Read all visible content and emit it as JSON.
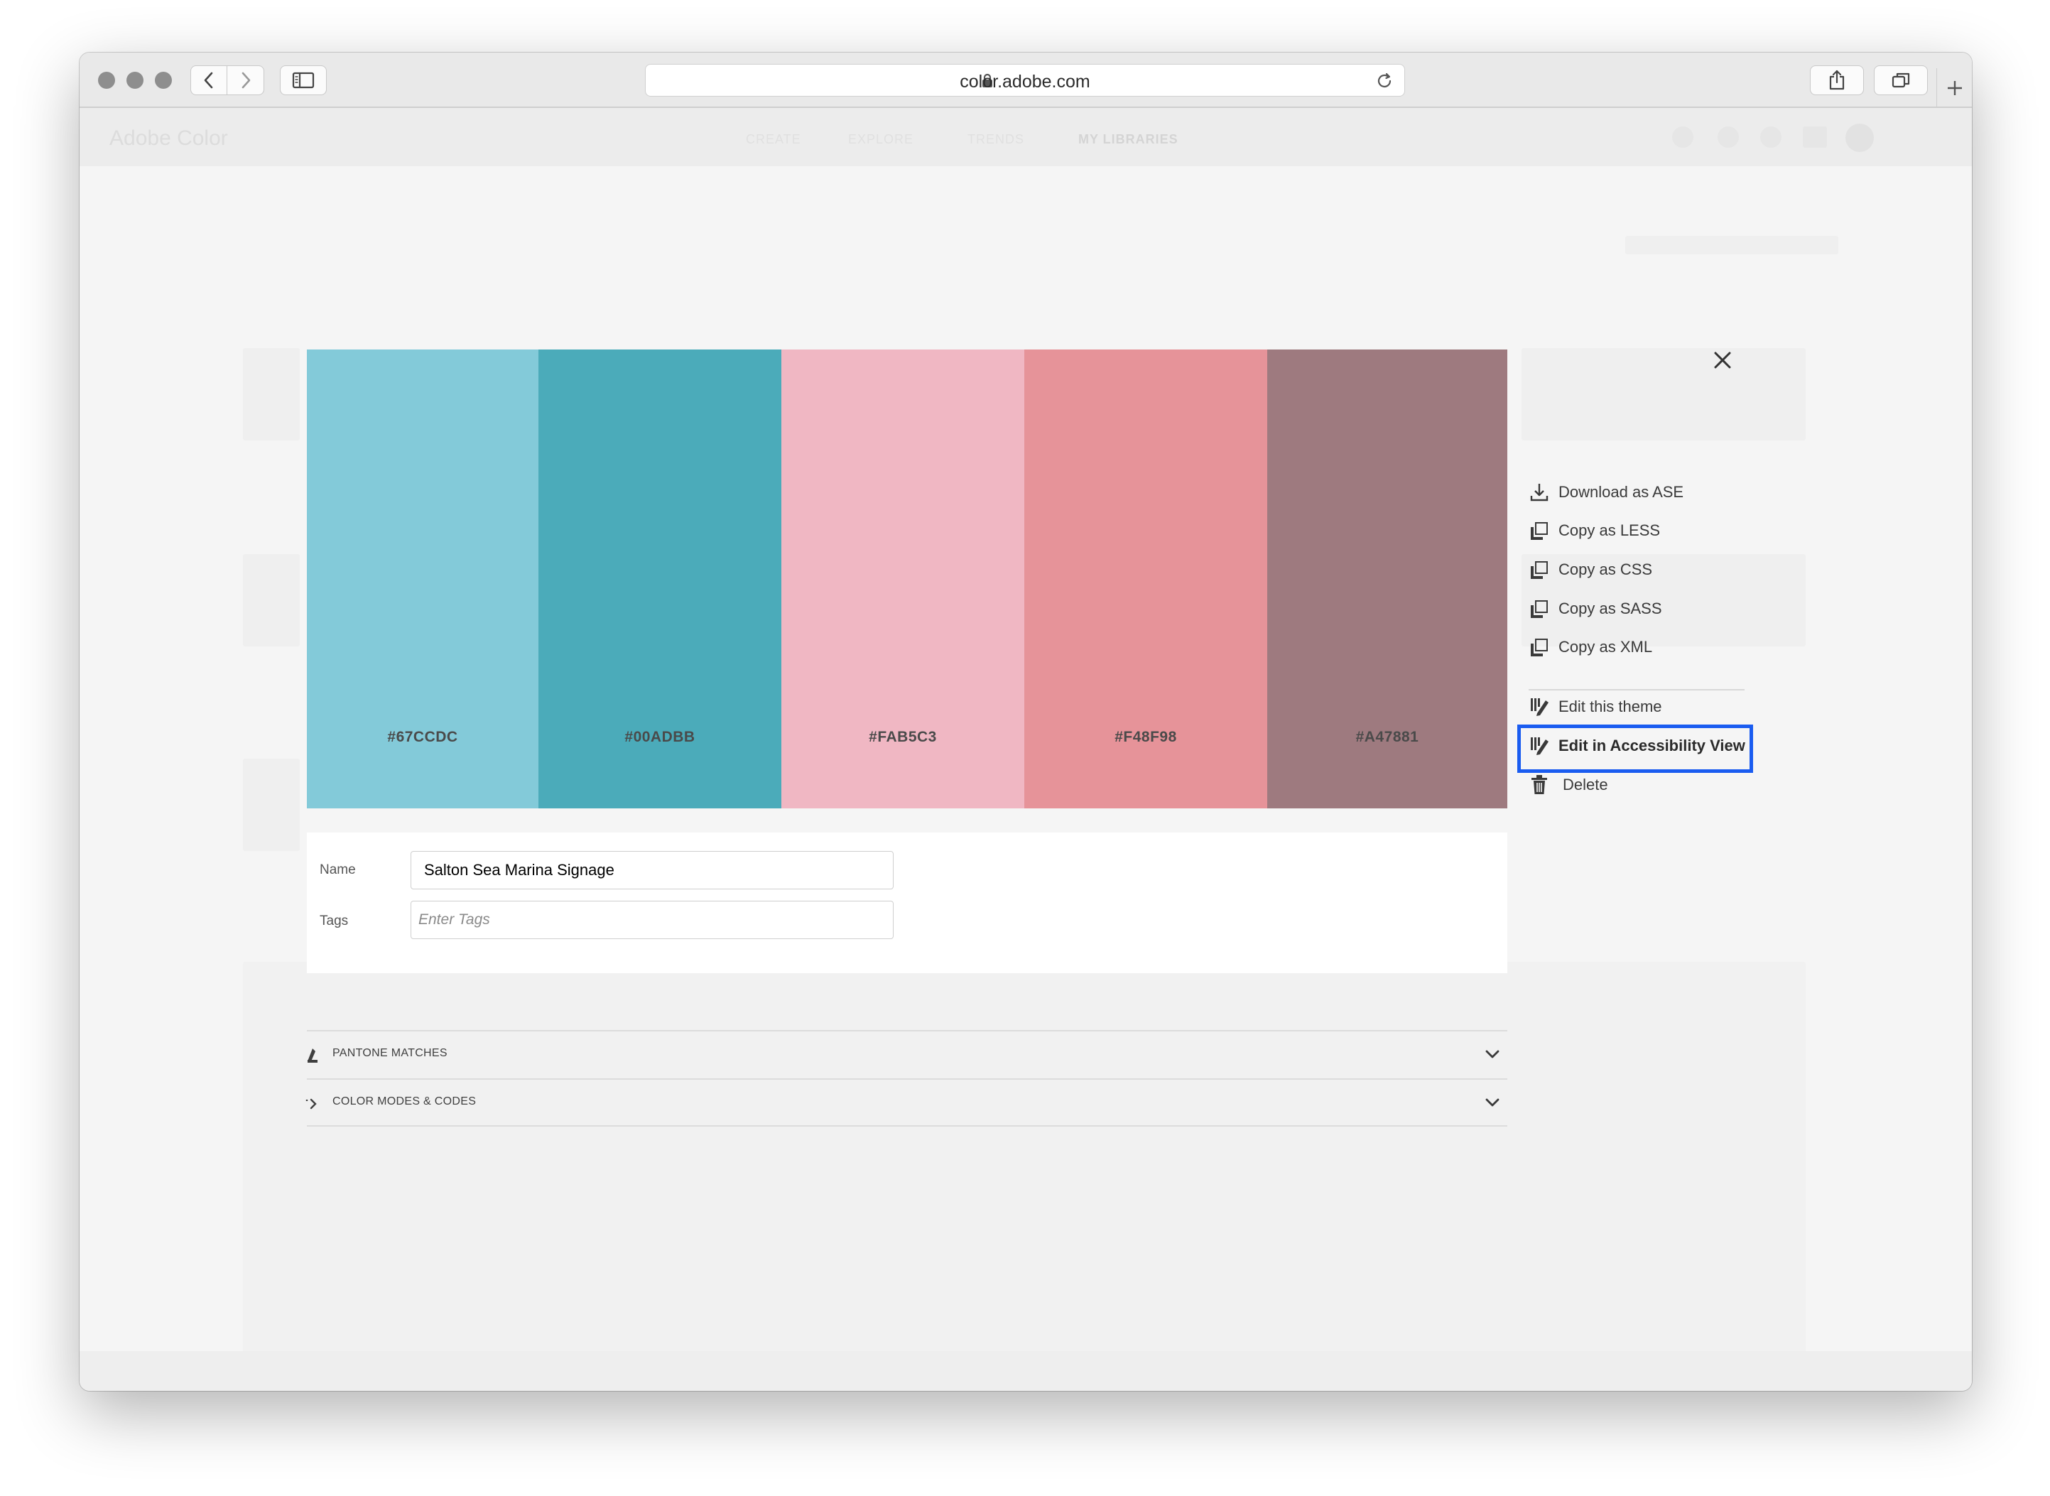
{
  "browser": {
    "url": "color.adobe.com"
  },
  "page": {
    "logo": "Adobe Color",
    "nav": [
      "CREATE",
      "EXPLORE",
      "TRENDS",
      "MY LIBRARIES"
    ]
  },
  "theme": {
    "swatches": [
      {
        "hex": "#67CCDC",
        "color": "#83CAD9"
      },
      {
        "hex": "#00ADBB",
        "color": "#4BABBA"
      },
      {
        "hex": "#FAB5C3",
        "color": "#F0B7C3"
      },
      {
        "hex": "#F48F98",
        "color": "#E69399"
      },
      {
        "hex": "#A47881",
        "color": "#9E7A7F"
      }
    ],
    "name_label": "Name",
    "name_value": "Salton Sea Marina Signage",
    "tags_label": "Tags",
    "tags_placeholder": "Enter Tags"
  },
  "accordions": [
    {
      "label": "PANTONE MATCHES"
    },
    {
      "label": "COLOR MODES & CODES"
    }
  ],
  "actions_menu": {
    "items": [
      {
        "label": "Download as ASE",
        "icon": "download-icon"
      },
      {
        "label": "Copy as LESS",
        "icon": "copy-icon"
      },
      {
        "label": "Copy as CSS",
        "icon": "copy-icon"
      },
      {
        "label": "Copy as SASS",
        "icon": "copy-icon"
      },
      {
        "label": "Copy as XML",
        "icon": "copy-icon"
      },
      {
        "label": "Edit this theme",
        "icon": "edit-theme-icon"
      },
      {
        "label": "Edit in Accessibility View",
        "icon": "edit-theme-icon"
      },
      {
        "label": "Delete",
        "icon": "trash-icon"
      }
    ],
    "highlight_color": "#1A5CF0"
  }
}
